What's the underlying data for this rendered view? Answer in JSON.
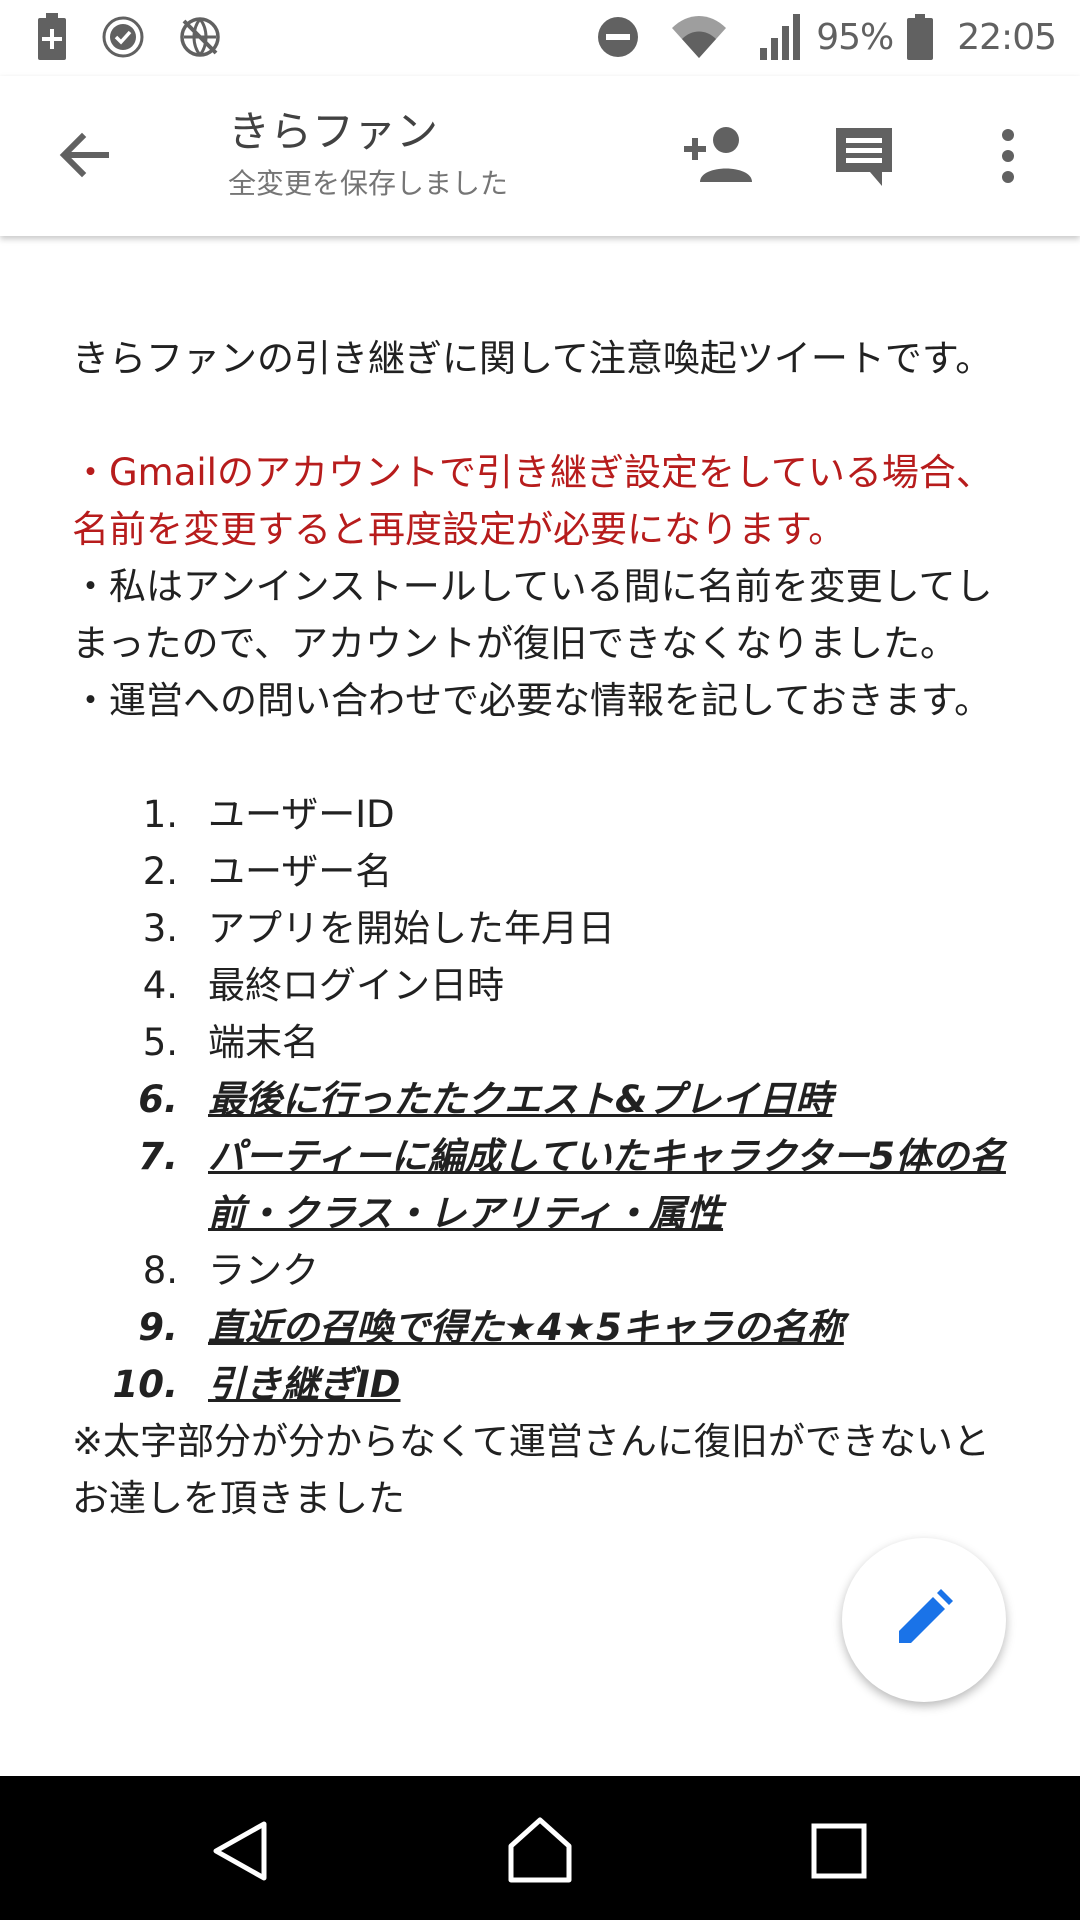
{
  "status_bar": {
    "battery_percent": "95%",
    "time": "22:05",
    "icons_left": [
      "battery-saver-icon",
      "check-circle-icon",
      "no-network-icon"
    ],
    "icons_right": [
      "do-not-disturb-icon",
      "wifi-icon",
      "signal-icon",
      "battery-icon"
    ]
  },
  "app_bar": {
    "title": "きらファン",
    "subtitle": "全変更を保存しました",
    "icons": [
      "back-arrow-icon",
      "add-person-icon",
      "comment-icon",
      "more-vert-icon"
    ]
  },
  "document": {
    "intro": "きらファンの引き継ぎに関して注意喚起ツイートです。",
    "warning": "・Gmailのアカウントで引き継ぎ設定をしている場合、名前を変更すると再度設定が必要になります。",
    "note1": "・私はアンインストールしている間に名前を変更してしまったので、アカウントが復旧できなくなりました。",
    "note2": "・運営への問い合わせで必要な情報を記しておきます。",
    "list": [
      {
        "num": "1.",
        "text": "ユーザーID",
        "bold": false
      },
      {
        "num": "2.",
        "text": "ユーザー名",
        "bold": false
      },
      {
        "num": "3.",
        "text": "アプリを開始した年月日",
        "bold": false
      },
      {
        "num": "4.",
        "text": "最終ログイン日時",
        "bold": false
      },
      {
        "num": "5.",
        "text": "端末名",
        "bold": false
      },
      {
        "num": "6.",
        "text": "最後に行ったたクエスト&プレイ日時",
        "bold": true
      },
      {
        "num": "7.",
        "text": "パーティーに編成していたキャラクター5体の名前・クラス・レアリティ・属性",
        "bold": true
      },
      {
        "num": "8.",
        "text": "ランク",
        "bold": false
      },
      {
        "num": "9.",
        "text": "直近の召喚で得た★4★5キャラの名称",
        "bold": true
      },
      {
        "num": "10.",
        "text": "引き継ぎID",
        "bold": true
      }
    ],
    "footnote": "※太字部分が分からなくて運営さんに復旧ができないとお達しを頂きました"
  },
  "fab": {
    "icon": "edit-pencil-icon",
    "color": "#1a73e8"
  },
  "nav_bar": {
    "icons": [
      "nav-back-icon",
      "nav-home-icon",
      "nav-recents-icon"
    ]
  },
  "colors": {
    "warning_text": "#b71c1c",
    "body_text": "#212121"
  }
}
